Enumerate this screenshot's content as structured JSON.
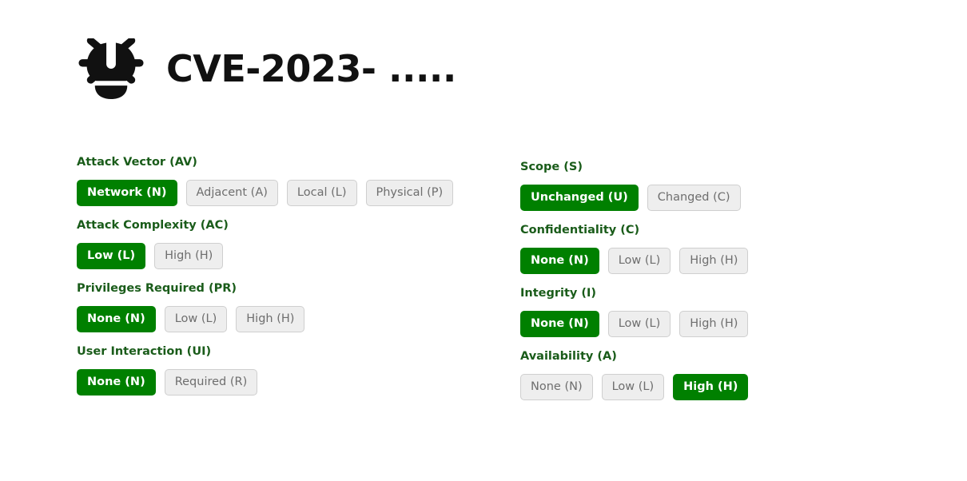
{
  "header": {
    "icon": "bug-icon",
    "title": "CVE-2023- ....."
  },
  "colors": {
    "selected_background": "#008000",
    "selected_text": "#ffffff",
    "unselected_background": "#eeeeee",
    "unselected_border": "#cfcfcf",
    "unselected_text": "#6e6e6e",
    "metric_label": "#1a5c1a",
    "title_text": "#111111",
    "page_background": "#ffffff"
  },
  "left_column": [
    {
      "label": "Attack Vector (AV)",
      "options": [
        {
          "text": "Network (N)",
          "selected": true
        },
        {
          "text": "Adjacent (A)",
          "selected": false
        },
        {
          "text": "Local (L)",
          "selected": false
        },
        {
          "text": "Physical (P)",
          "selected": false
        }
      ]
    },
    {
      "label": "Attack Complexity (AC)",
      "options": [
        {
          "text": "Low (L)",
          "selected": true
        },
        {
          "text": "High (H)",
          "selected": false
        }
      ]
    },
    {
      "label": "Privileges Required (PR)",
      "options": [
        {
          "text": "None (N)",
          "selected": true
        },
        {
          "text": "Low (L)",
          "selected": false
        },
        {
          "text": "High (H)",
          "selected": false
        }
      ]
    },
    {
      "label": "User Interaction (UI)",
      "options": [
        {
          "text": "None (N)",
          "selected": true
        },
        {
          "text": "Required (R)",
          "selected": false
        }
      ]
    }
  ],
  "right_column": [
    {
      "label": "Scope (S)",
      "options": [
        {
          "text": "Unchanged (U)",
          "selected": true
        },
        {
          "text": "Changed (C)",
          "selected": false
        }
      ]
    },
    {
      "label": "Confidentiality (C)",
      "options": [
        {
          "text": "None (N)",
          "selected": true
        },
        {
          "text": "Low (L)",
          "selected": false
        },
        {
          "text": "High (H)",
          "selected": false
        }
      ]
    },
    {
      "label": "Integrity (I)",
      "options": [
        {
          "text": "None (N)",
          "selected": true
        },
        {
          "text": "Low (L)",
          "selected": false
        },
        {
          "text": "High (H)",
          "selected": false
        }
      ]
    },
    {
      "label": "Availability (A)",
      "options": [
        {
          "text": "None (N)",
          "selected": false
        },
        {
          "text": "Low (L)",
          "selected": false
        },
        {
          "text": "High (H)",
          "selected": true
        }
      ]
    }
  ]
}
